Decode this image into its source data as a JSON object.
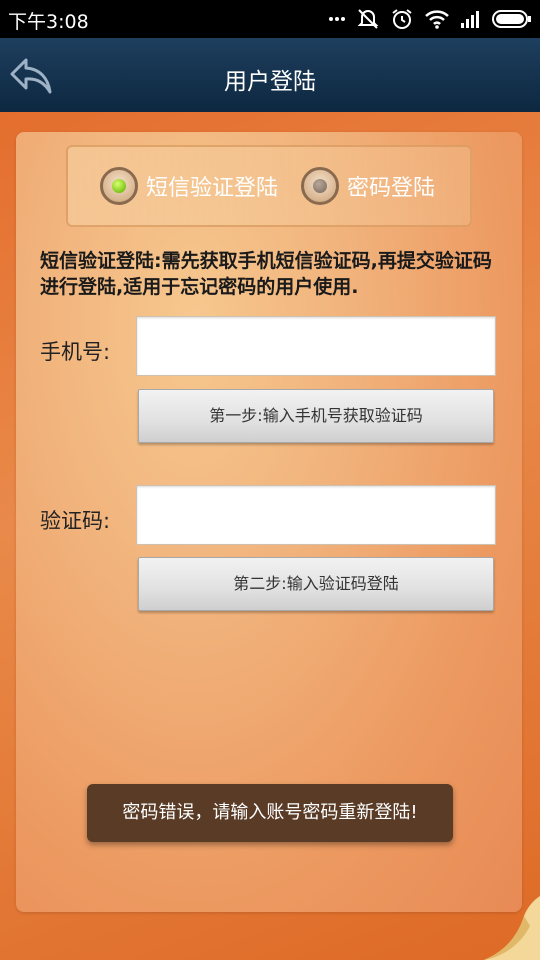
{
  "status_bar": {
    "time": "下午3:08",
    "icons": [
      "more-icon",
      "notification-muted-icon",
      "alarm-icon",
      "wifi-icon",
      "signal-icon",
      "battery-icon"
    ]
  },
  "header": {
    "title": "用户登陆",
    "back_icon": "back-arrow-icon"
  },
  "login_mode": {
    "options": [
      {
        "label": "短信验证登陆",
        "selected": true
      },
      {
        "label": "密码登陆",
        "selected": false
      }
    ]
  },
  "description": "短信验证登陆:需先获取手机短信验证码,再提交验证码进行登陆,适用于忘记密码的用户使用.",
  "phone": {
    "label": "手机号:",
    "value": "",
    "placeholder": ""
  },
  "step1_button": "第一步:输入手机号获取验证码",
  "code": {
    "label": "验证码:",
    "value": "",
    "placeholder": ""
  },
  "step2_button": "第二步:输入验证码登陆",
  "toast": "密码错误，请输入账号密码重新登陆!",
  "colors": {
    "header_bg": "#15324f",
    "panel_accent": "#e4762f",
    "toast_bg": "#5a3b26",
    "radio_selected": "#7cc618"
  }
}
